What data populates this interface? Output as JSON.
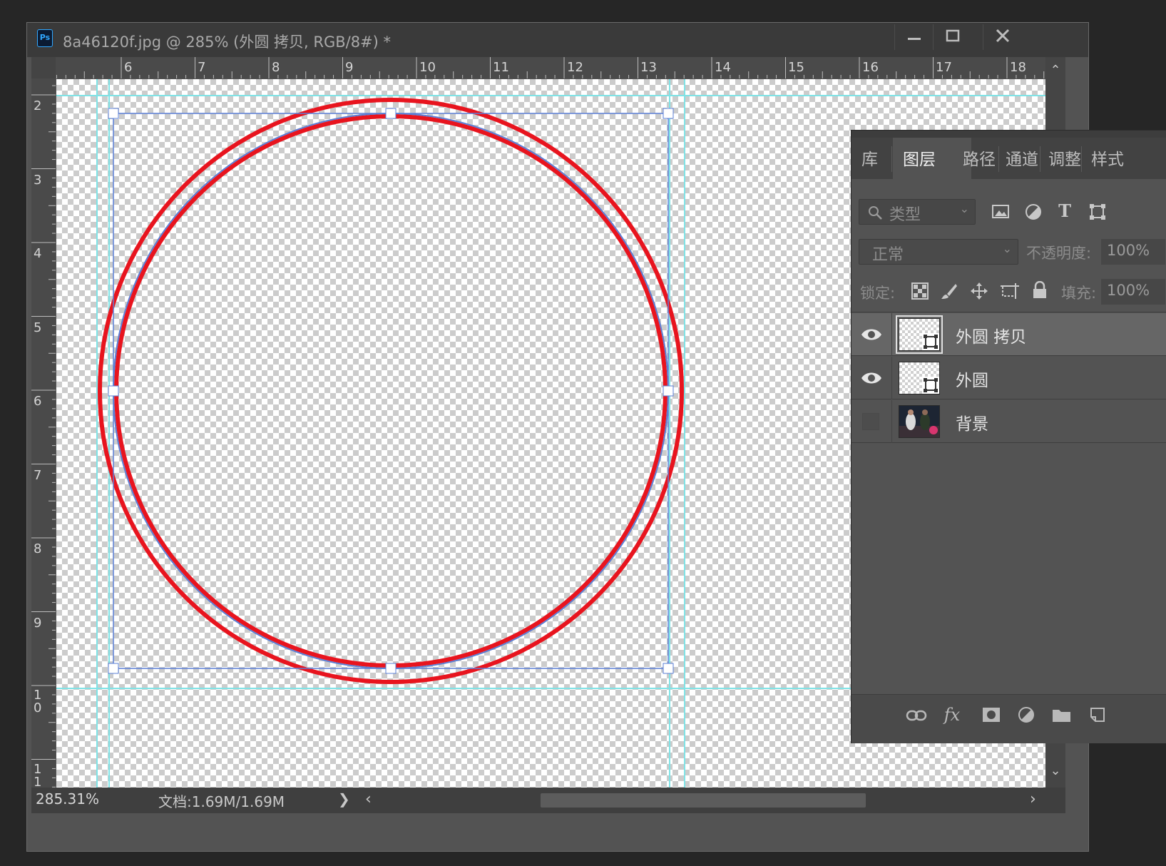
{
  "document": {
    "app_icon": "Ps",
    "title": "8a46120f.jpg @ 285% (外圆 拷贝, RGB/8#) *",
    "window_buttons": [
      "minimize-icon",
      "maximize-icon",
      "close-icon"
    ]
  },
  "rulers": {
    "top": [
      "6",
      "7",
      "8",
      "9",
      "10",
      "11",
      "12",
      "13",
      "14",
      "15",
      "16",
      "17",
      "18"
    ],
    "left": [
      "2",
      "3",
      "4",
      "5",
      "6",
      "7",
      "8",
      "9",
      "1\n0",
      "1\n1"
    ]
  },
  "status": {
    "zoom": "285.31%",
    "doc_size": "文档:1.69M/1.69M",
    "more_arrow": "❯",
    "hscroll_left": "‹",
    "hscroll_right": "›",
    "vscroll_up": "⌃",
    "vscroll_down": "⌄"
  },
  "layers_panel": {
    "tabs": [
      "库",
      "图层",
      "路径",
      "通道",
      "调整",
      "样式"
    ],
    "active_tab": "图层",
    "filter_label": "类型",
    "blend_mode": "正常",
    "opacity_label": "不透明度:",
    "opacity_value": "100%",
    "lock_label": "锁定:",
    "fill_label": "填充:",
    "fill_value": "100%",
    "layers": [
      {
        "name": "外圆 拷贝",
        "visible": true,
        "selected": true,
        "thumb": "shape"
      },
      {
        "name": "外圆",
        "visible": true,
        "selected": false,
        "thumb": "shape"
      },
      {
        "name": "背景",
        "visible": false,
        "selected": false,
        "thumb": "photo"
      }
    ],
    "footer_icons": [
      "link-icon",
      "fx-icon",
      "mask-icon",
      "adjustment-icon",
      "folder-icon",
      "new-layer-icon"
    ]
  },
  "colors": {
    "guide": "#7fe3e6",
    "circle_stroke": "#e8141e",
    "bounding_box": "#5b7fd6",
    "panel_bg": "#535353"
  }
}
